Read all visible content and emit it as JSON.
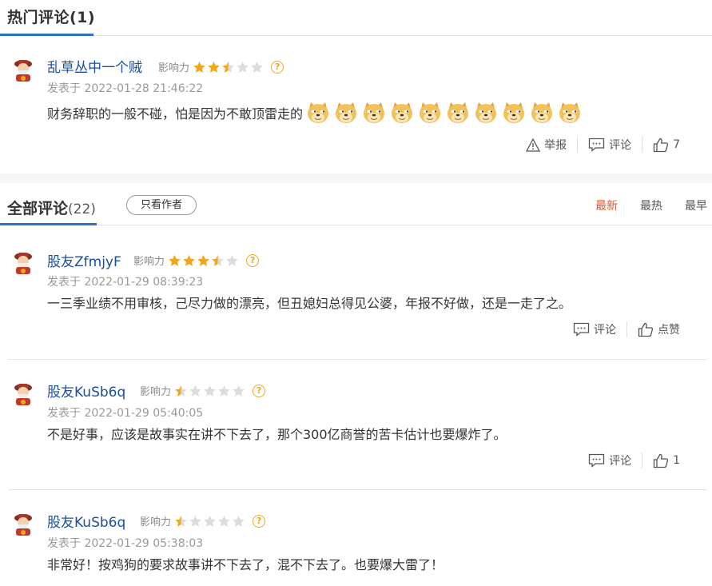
{
  "hot": {
    "title": "热门评论(1)",
    "comments": [
      {
        "username": "乱草丛中一个贼",
        "influence_label": "影响力",
        "stars": 2.5,
        "posted": "发表于 2022-01-28 21:46:22",
        "text": "财务辞职的一般不碰，怕是因为不敢顶雷走的",
        "emoji_count": 10,
        "report_label": "举报",
        "comment_label": "评论",
        "likes": "7"
      }
    ]
  },
  "all": {
    "title": "全部评论",
    "count": "(22)",
    "author_only_label": "只看作者",
    "sort": [
      "最新",
      "最热",
      "最早"
    ],
    "active_sort": "最新",
    "comments": [
      {
        "username": "股友ZfmjyF",
        "influence_label": "影响力",
        "stars": 3.5,
        "posted": "发表于 2022-01-29 08:39:23",
        "text": "一三季业绩不用审核，己尽力做的漂亮，但丑媳妇总得见公婆，年报不好做，还是一走了之。",
        "comment_label": "评论",
        "like_label": "点赞"
      },
      {
        "username": "股友KuSb6q",
        "influence_label": "影响力",
        "stars": 0.5,
        "posted": "发表于 2022-01-29 05:40:05",
        "text": "不是好事，应该是故事实在讲不下去了，那个300亿商誉的苦卡估计也要爆炸了。",
        "comment_label": "评论",
        "like_label": "1"
      },
      {
        "username": "股友KuSb6q",
        "influence_label": "影响力",
        "stars": 0.5,
        "posted": "发表于 2022-01-29 05:38:03",
        "text": "非常好！按鸡狗的要求故事讲不下去了，混不下去了。也要爆大雷了！"
      }
    ]
  },
  "colors": {
    "username": "#1a4fa0",
    "accent": "#2f6fc6",
    "active_sort": "#e2572c",
    "star": "#f0a81a"
  },
  "icons": {
    "avatar": "god-of-wealth-avatar",
    "help": "question-circle-icon",
    "report": "warning-triangle-icon",
    "comment": "comment-bubble-icon",
    "like": "thumbs-up-icon",
    "emoji": "doge-emoji"
  }
}
